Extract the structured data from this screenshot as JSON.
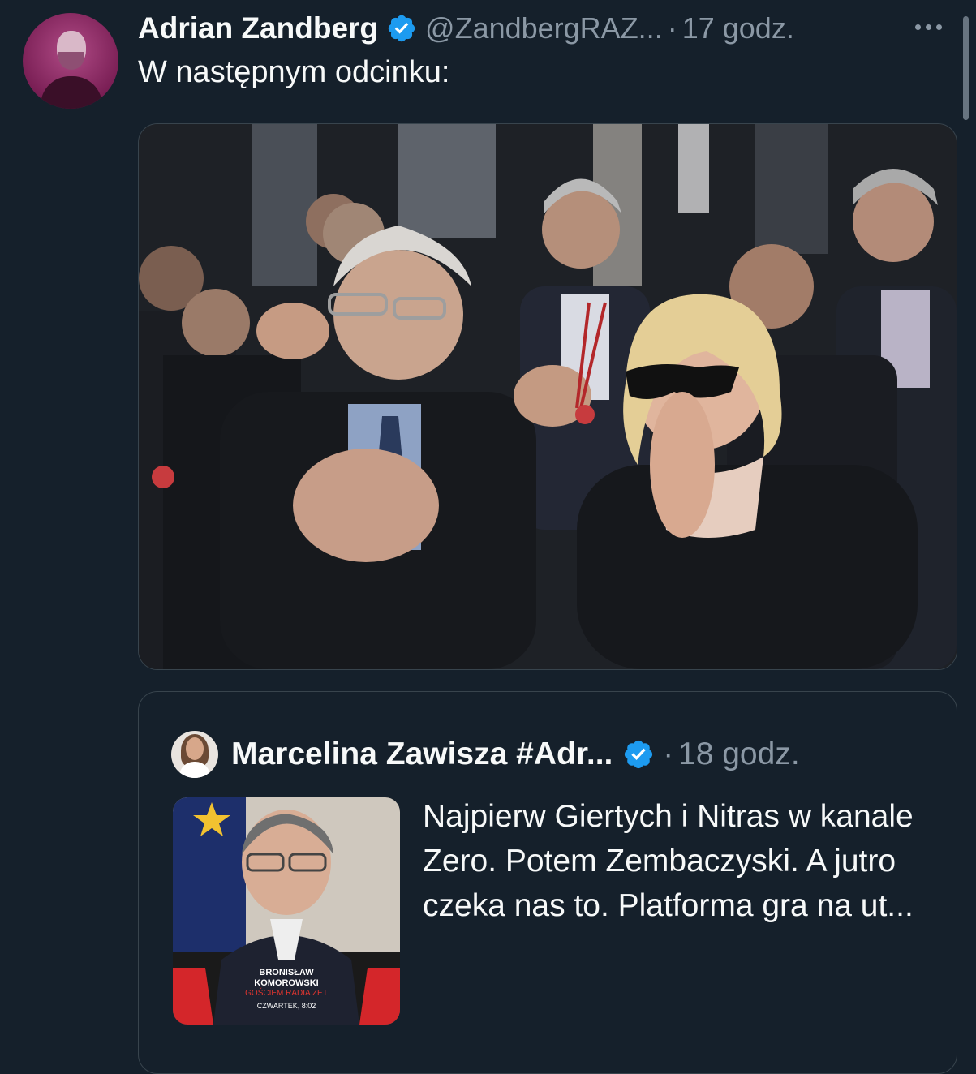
{
  "tweet": {
    "author_name": "Adrian Zandberg",
    "handle": "@ZandbergRAZ...",
    "separator": "·",
    "time": "17 godz.",
    "verified": true,
    "text": "W następnym odcinku:",
    "more_icon": "more-horizontal-icon"
  },
  "quoted_tweet": {
    "author_name": "Marcelina Zawisza #Adr...",
    "separator": "·",
    "time": "18 godz.",
    "verified": true,
    "text": "Najpierw Giertych i Nitras w kanale Zero. Potem Zembaczyski. A jutro czeka nas to. Platforma gra na ut...",
    "thumbnail": {
      "line1": "BRONISŁAW",
      "line2": "KOMOROWSKI",
      "line3": "GOŚCIEM RADIA ZET",
      "line4": "CZWARTEK, 8:02"
    }
  },
  "colors": {
    "background": "#15202b",
    "text": "#f7f9f9",
    "muted": "#8b98a5",
    "verified": "#1d9bf0",
    "border": "#38444d"
  }
}
